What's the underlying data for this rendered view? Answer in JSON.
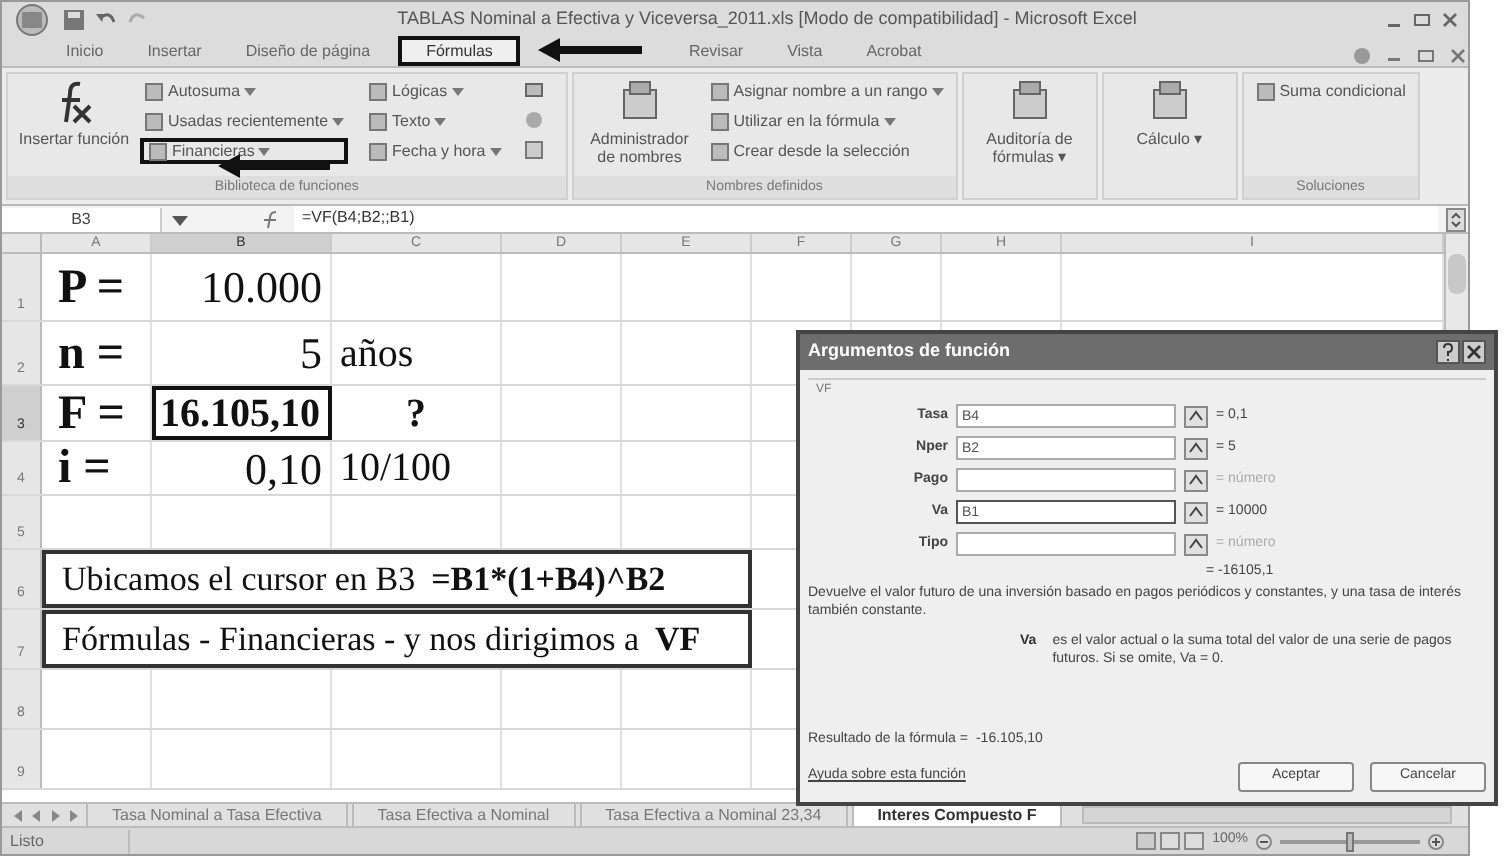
{
  "window": {
    "title": "TABLAS Nominal a Efectiva y Viceversa_2011.xls  [Modo de compatibilidad] - Microsoft Excel"
  },
  "tabs": [
    {
      "label": "Inicio",
      "selected": false
    },
    {
      "label": "Insertar",
      "selected": false
    },
    {
      "label": "Diseño de página",
      "selected": false
    },
    {
      "label": "Fórmulas",
      "selected": true
    },
    {
      "label": "Revisar",
      "selected": false
    },
    {
      "label": "Vista",
      "selected": false
    },
    {
      "label": "Acrobat",
      "selected": false
    }
  ],
  "ribbon": [
    {
      "label": "Biblioteca de funciones",
      "items": [
        {
          "kind": "large",
          "label": "Insertar función"
        },
        {
          "kind": "small",
          "label": "Autosuma",
          "dropdown": true,
          "highlighted": false
        },
        {
          "kind": "small",
          "label": "Usadas recientemente",
          "dropdown": true,
          "highlighted": false
        },
        {
          "kind": "small",
          "label": "Financieras",
          "dropdown": true,
          "highlighted": true
        },
        {
          "kind": "small",
          "label": "Lógicas",
          "dropdown": true,
          "highlighted": false
        },
        {
          "kind": "small",
          "label": "Texto",
          "dropdown": true,
          "highlighted": false
        },
        {
          "kind": "small",
          "label": "Fecha y hora",
          "dropdown": true,
          "highlighted": false
        },
        {
          "kind": "icon"
        },
        {
          "kind": "icon"
        },
        {
          "kind": "icon"
        }
      ]
    },
    {
      "label": "Nombres definidos",
      "items": [
        {
          "kind": "large",
          "label": "Administrador de nombres"
        },
        {
          "kind": "small",
          "label": "Asignar nombre a un rango",
          "dropdown": true,
          "highlighted": false
        },
        {
          "kind": "small",
          "label": "Utilizar en la fórmula",
          "dropdown": true,
          "highlighted": false
        },
        {
          "kind": "small",
          "label": "Crear desde la selección",
          "dropdown": false,
          "highlighted": false
        }
      ]
    },
    {
      "items": [
        {
          "kind": "large",
          "label": "Auditoría de fórmulas ▾"
        }
      ]
    },
    {
      "items": [
        {
          "kind": "large",
          "label": "Cálculo ▾"
        }
      ]
    },
    {
      "label": "Soluciones",
      "items": [
        {
          "kind": "small",
          "label": "Suma condicional",
          "dropdown": false,
          "highlighted": false
        }
      ]
    }
  ],
  "formula_bar": {
    "name_box": "B3",
    "formula": "=VF(B4;B2;;B1)"
  },
  "columns": [
    {
      "label": "A",
      "selected": false
    },
    {
      "label": "B",
      "selected": true
    },
    {
      "label": "C",
      "selected": false
    },
    {
      "label": "D",
      "selected": false
    },
    {
      "label": "E",
      "selected": false
    },
    {
      "label": "F",
      "selected": false
    },
    {
      "label": "G",
      "selected": false
    },
    {
      "label": "H",
      "selected": false
    },
    {
      "label": "I",
      "selected": false
    }
  ],
  "rows": [
    {
      "number": "1",
      "kind": "values",
      "selected": false,
      "a": "P =",
      "b": "10.000",
      "b_bold": false
    },
    {
      "number": "2",
      "kind": "values",
      "selected": false,
      "a": "n =",
      "b": "5",
      "c": "años",
      "b_bold": false
    },
    {
      "number": "3",
      "kind": "values",
      "selected": true,
      "a": "F =",
      "b": "16.105,10",
      "c": "?",
      "b_bold": true
    },
    {
      "number": "4",
      "kind": "values",
      "selected": false,
      "a": "i =",
      "b": "0,10",
      "c": "10/100",
      "b_bold": false
    },
    {
      "number": "5",
      "kind": "blank",
      "selected": false
    },
    {
      "number": "6",
      "kind": "note",
      "selected": false,
      "text": "Ubicamos el cursor en B3 **=B1*(1+B4)^B2**"
    },
    {
      "number": "7",
      "kind": "note",
      "selected": false,
      "text": "Fórmulas - Financieras - y nos dirigimos a **VF**"
    },
    {
      "number": "8",
      "kind": "blank",
      "selected": false
    },
    {
      "number": "9",
      "kind": "blank",
      "selected": false
    }
  ],
  "sheet_tabs": [
    {
      "label": "Tasa Nominal a Tasa Efectiva",
      "selected": false
    },
    {
      "label": "Tasa Efectiva a Nominal",
      "selected": false
    },
    {
      "label": "Tasa Efectiva a Nominal 23,34",
      "selected": false
    },
    {
      "label": "Interes Compuesto F",
      "selected": true
    }
  ],
  "status_bar": {
    "status": "Listo",
    "zoom": "100%",
    "level": 0.5
  },
  "dialog": {
    "title": "Argumentos de función",
    "function": "VF",
    "args": [
      {
        "label": "Tasa",
        "value": "B4",
        "result": "= 0,1",
        "muted": false,
        "focused": false
      },
      {
        "label": "Nper",
        "value": "B2",
        "result": "= 5",
        "muted": false,
        "focused": false
      },
      {
        "label": "Pago",
        "result": "= número",
        "muted": true,
        "focused": false
      },
      {
        "label": "Va",
        "value": "B1",
        "result": "= 10000",
        "muted": false,
        "focused": true
      },
      {
        "label": "Tipo",
        "result": "= número",
        "muted": true,
        "focused": false
      }
    ],
    "total": "= -16105,1",
    "description": "Devuelve el valor futuro de una inversión basado en pagos periódicos y constantes, y una tasa de interés también constante.",
    "arg_name": "Va",
    "arg_help": "es el valor actual o la suma total del valor de una serie de pagos futuros. Si se omite, Va = 0.",
    "result_label": "Resultado de la fórmula =",
    "result_value": "-16.105,10",
    "help_link": "Ayuda sobre esta función",
    "buttons": [
      "Aceptar",
      "Cancelar"
    ]
  }
}
